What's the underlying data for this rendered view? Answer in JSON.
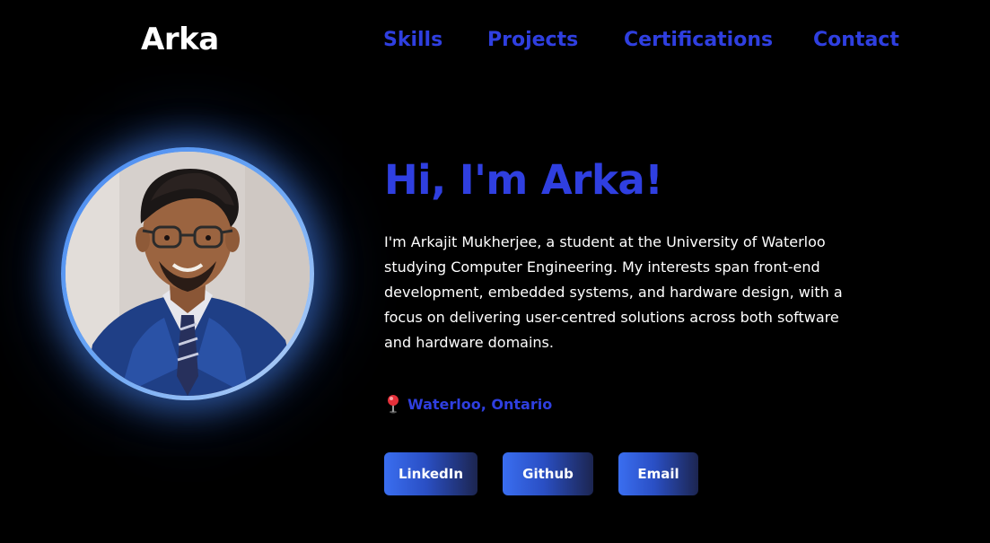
{
  "header": {
    "brand": "Arka",
    "nav": [
      {
        "label": "Skills"
      },
      {
        "label": "Projects"
      },
      {
        "label": "Certifications"
      },
      {
        "label": "Contact"
      }
    ]
  },
  "hero": {
    "greeting": "Hi, I'm Arka!",
    "bio": "I'm Arkajit Mukherjee, a student at the University of Waterloo studying Computer Engineering. My interests span front-end development, embedded systems, and hardware design, with a focus on delivering user-centred solutions across both software and hardware domains.",
    "location": "Waterloo, Ontario",
    "location_icon": "map-pin-icon",
    "buttons": [
      {
        "label": "LinkedIn"
      },
      {
        "label": "Github"
      },
      {
        "label": "Email"
      }
    ]
  },
  "colors": {
    "background": "#000000",
    "accent": "#2f3fe0",
    "text": "#ffffff",
    "button_gradient_start": "#3a6ef0",
    "button_gradient_end": "#1c2550"
  }
}
